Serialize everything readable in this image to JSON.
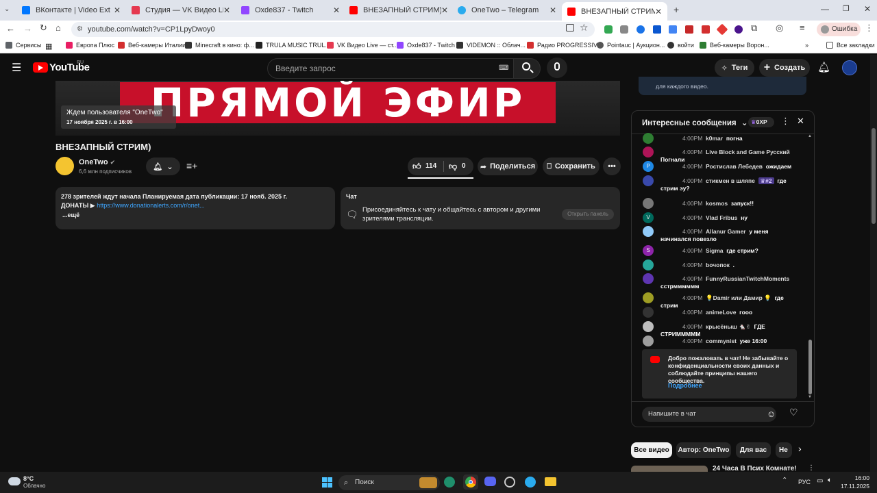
{
  "tabs": [
    {
      "label": "ВКонтакте | Video Ext",
      "color": "#0077ff"
    },
    {
      "label": "Студия — VK Видео Live",
      "color": "#e53950"
    },
    {
      "label": "Oxde837 - Twitch",
      "color": "#9146ff"
    },
    {
      "label": "ВНЕЗАПНЫЙ СТРИМ) - YouTube",
      "color": "#ff0000"
    },
    {
      "label": "OneTwo – Telegram",
      "color": "#2aabee"
    },
    {
      "label": "ВНЕЗАПНЫЙ СТРИМ) - YouTube",
      "color": "#ff0000"
    }
  ],
  "address": {
    "url": "youtube.com/watch?v=CP1LpyDwoy0"
  },
  "error_label": "Ошибка",
  "bookmarks": [
    {
      "label": "Сервисы"
    },
    {
      "label": "Европа Плюс"
    },
    {
      "label": "Веб-камеры Италии"
    },
    {
      "label": "Minecraft в кино: ф..."
    },
    {
      "label": "TRULA MUSIC TRUL..."
    },
    {
      "label": "VK Видео Live — ст..."
    },
    {
      "label": "Oxde837 - Twitch"
    },
    {
      "label": "VIDEMON :: Облач..."
    },
    {
      "label": "Радио PROGRESSIV..."
    },
    {
      "label": "Pointauc | Аукцион..."
    },
    {
      "label": "войти"
    },
    {
      "label": "Веб-камеры Ворон..."
    },
    {
      "label": "Все закладки"
    }
  ],
  "yt": {
    "logo": "YouTube",
    "region": "RU",
    "search_placeholder": "Введите запрос",
    "tags_label": "Теги",
    "create_label": "Создать"
  },
  "player": {
    "banner": "ПРЯМОЙ ЭФИР",
    "waiting": "Ждем пользователя \"OneTwo\"",
    "date": "17 ноября 2025 г. в 16:00"
  },
  "video": {
    "title": "ВНЕЗАПНЫЙ СТРИМ)",
    "channel": "OneTwo",
    "subs": "6,6 млн подписчиков",
    "likes": "114",
    "dislikes": "0",
    "share": "Поделиться",
    "save": "Сохранить",
    "desc_line1": "278 зрителей ждут начала  Планируемая дата публикации: 17 нояб. 2025 г.",
    "desc_donate": "ДОНАТЫ ▶ ",
    "desc_link": "https://www.donationalerts.com/r/onet...",
    "desc_more": "...ещё",
    "chat_title": "Чат",
    "chat_text": "Присоединяйтесь к чату и общайтесь с автором и другими зрителями трансляции.",
    "chat_open": "Открыть панель"
  },
  "top_card_text": "для каждого видео.",
  "chat": {
    "header": "Интересные сообщения",
    "points": "0XP",
    "messages": [
      {
        "time": "4:00PM",
        "author": "k0mar",
        "text": "погна",
        "color": "#2e7d32"
      },
      {
        "time": "4:00PM",
        "author": "Live Block and Game Русский",
        "text": "Погнали",
        "color": "#ad1457"
      },
      {
        "time": "4:00PM",
        "author": "Ростислав Лебедев",
        "text": "ожидаем",
        "color": "#1e88e5",
        "letter": "Р"
      },
      {
        "time": "4:00PM",
        "author": "стикмен в шляпе",
        "badge": "#2",
        "text": "где стрим эу?",
        "color": "#3949ab"
      },
      {
        "time": "4:00PM",
        "author": "kosmos",
        "text": "запуск!!",
        "color": "#777"
      },
      {
        "time": "4:00PM",
        "author": "Vlad Fribus",
        "text": "ну",
        "color": "#00695c",
        "letter": "V"
      },
      {
        "time": "4:00PM",
        "author": "Allanur Gamer",
        "text": "у меня начинался повезло",
        "color": "#90caf9"
      },
      {
        "time": "4:00PM",
        "author": "Sigma",
        "text": "где стрим?",
        "color": "#8e24aa",
        "letter": "S"
      },
      {
        "time": "4:00PM",
        "author": "bочопок",
        "text": ".",
        "color": "#26a69a"
      },
      {
        "time": "4:00PM",
        "author": "FunnyRussianTwitchMoments",
        "text": "сстрмммммм",
        "color": "#5e35b1"
      },
      {
        "time": "4:00PM",
        "author": "💡Damir или Дамир 💡",
        "text": "где стрим",
        "color": "#9e9d24"
      },
      {
        "time": "4:00PM",
        "author": "animeLove",
        "text": "гооо",
        "color": "#333"
      },
      {
        "time": "4:00PM",
        "author": "крысёныш 🐁✌",
        "text": "ГДЕ СТРИМММММ",
        "color": "#bdbdbd"
      },
      {
        "time": "4:00PM",
        "author": "commynist",
        "text": "уже 16:00",
        "color": "#9e9e9e"
      }
    ],
    "welcome": "Добро пожаловать в чат! Не забывайте о конфиденциальности своих данных и соблюдайте принципы нашего сообщества.",
    "welcome_link": "Подробнее",
    "input_placeholder": "Напишите в чат"
  },
  "chips": [
    "Все видео",
    "Автор: OneTwo",
    "Для вас",
    "Не"
  ],
  "next_video": "24 Часа В Псих Комнате!",
  "taskbar": {
    "weather_temp": "8°C",
    "weather_desc": "Облачно",
    "search": "Поиск",
    "lang": "РУС",
    "time": "16:00",
    "date": "17.11.2025"
  }
}
